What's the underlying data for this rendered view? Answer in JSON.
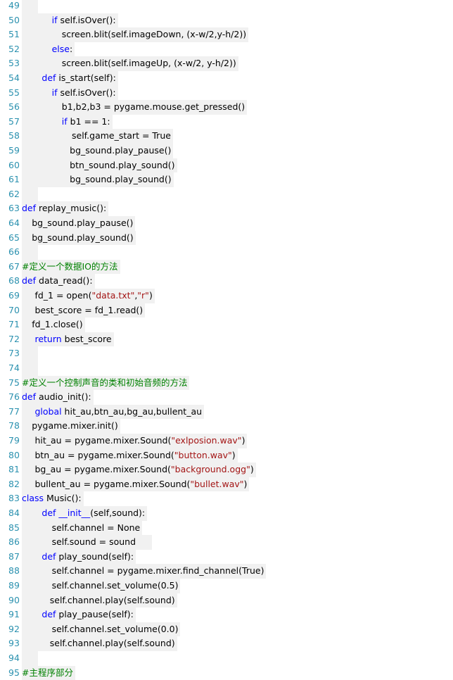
{
  "lines": [
    {
      "n": "49",
      "indent": 0,
      "t": []
    },
    {
      "n": "50",
      "indent": 3,
      "t": [
        [
          "kw",
          "if"
        ],
        [
          "n",
          " self.isOver():"
        ]
      ]
    },
    {
      "n": "51",
      "indent": 4,
      "t": [
        [
          "n",
          "screen.blit(self.imageDown, (x-w/2,y-h/2))"
        ]
      ]
    },
    {
      "n": "52",
      "indent": 3,
      "t": [
        [
          "kw",
          "else"
        ],
        [
          "n",
          ":"
        ]
      ]
    },
    {
      "n": "53",
      "indent": 4,
      "t": [
        [
          "n",
          "screen.blit(self.imageUp, (x-w/2, y-h/2))"
        ]
      ]
    },
    {
      "n": "54",
      "indent": 2,
      "t": [
        [
          "kw",
          "def"
        ],
        [
          "n",
          " is_start(self):"
        ]
      ]
    },
    {
      "n": "55",
      "indent": 3,
      "t": [
        [
          "kw",
          "if"
        ],
        [
          "n",
          " self.isOver():"
        ]
      ]
    },
    {
      "n": "56",
      "indent": 4,
      "t": [
        [
          "n",
          "b1,b2,b3 = pygame.mouse.get_pressed()"
        ]
      ]
    },
    {
      "n": "57",
      "indent": 4,
      "t": [
        [
          "kw",
          "if"
        ],
        [
          "n",
          " b1 == 1:"
        ]
      ]
    },
    {
      "n": "58",
      "indent": 5,
      "t": [
        [
          "n",
          "self.game_start = True"
        ]
      ]
    },
    {
      "n": "59",
      "indent": 4.8,
      "t": [
        [
          "n",
          "bg_sound.play_pause()"
        ]
      ]
    },
    {
      "n": "60",
      "indent": 4.8,
      "t": [
        [
          "n",
          "btn_sound.play_sound()"
        ]
      ]
    },
    {
      "n": "61",
      "indent": 4.8,
      "t": [
        [
          "n",
          "bg_sound.play_sound()"
        ]
      ]
    },
    {
      "n": "62",
      "indent": 0,
      "t": []
    },
    {
      "n": "63",
      "indent": 0,
      "t": [
        [
          "kw",
          "def"
        ],
        [
          "n",
          " replay_music():"
        ]
      ]
    },
    {
      "n": "64",
      "indent": 1,
      "t": [
        [
          "n",
          "bg_sound.play_pause()"
        ]
      ]
    },
    {
      "n": "65",
      "indent": 1,
      "t": [
        [
          "n",
          "bg_sound.play_sound()"
        ]
      ]
    },
    {
      "n": "66",
      "indent": 0,
      "t": []
    },
    {
      "n": "67",
      "indent": 0,
      "t": [
        [
          "cmt",
          "#定义一个数据IO的方法"
        ]
      ]
    },
    {
      "n": "68",
      "indent": 0,
      "t": [
        [
          "kw",
          "def"
        ],
        [
          "n",
          " data_read():"
        ]
      ]
    },
    {
      "n": "69",
      "indent": 1.3,
      "t": [
        [
          "n",
          "fd_1 = open("
        ],
        [
          "str",
          "\"data.txt\""
        ],
        [
          "n",
          ","
        ],
        [
          "str",
          "\"r\""
        ],
        [
          "n",
          ")"
        ]
      ]
    },
    {
      "n": "70",
      "indent": 1.3,
      "t": [
        [
          "n",
          "best_score = fd_1.read()"
        ]
      ]
    },
    {
      "n": "71",
      "indent": 1,
      "t": [
        [
          "n",
          "fd_1.close()"
        ]
      ]
    },
    {
      "n": "72",
      "indent": 1.3,
      "t": [
        [
          "kw",
          "return"
        ],
        [
          "n",
          " best_score"
        ]
      ]
    },
    {
      "n": "73",
      "indent": 0,
      "t": []
    },
    {
      "n": "74",
      "indent": 0,
      "t": []
    },
    {
      "n": "75",
      "indent": 0,
      "t": [
        [
          "cmt",
          "#定义一个控制声音的类和初始音频的方法"
        ]
      ]
    },
    {
      "n": "76",
      "indent": 0,
      "t": [
        [
          "kw",
          "def"
        ],
        [
          "n",
          " audio_init():"
        ]
      ]
    },
    {
      "n": "77",
      "indent": 1.3,
      "t": [
        [
          "kw",
          "global"
        ],
        [
          "n",
          " hit_au,btn_au,bg_au,bullent_au"
        ]
      ]
    },
    {
      "n": "78",
      "indent": 1,
      "t": [
        [
          "n",
          "pygame.mixer.init()"
        ]
      ]
    },
    {
      "n": "79",
      "indent": 1.3,
      "t": [
        [
          "n",
          "hit_au = pygame.mixer.Sound("
        ],
        [
          "str",
          "\"exlposion.wav\""
        ],
        [
          "n",
          ")"
        ]
      ]
    },
    {
      "n": "80",
      "indent": 1.3,
      "t": [
        [
          "n",
          "btn_au = pygame.mixer.Sound("
        ],
        [
          "str",
          "\"button.wav\""
        ],
        [
          "n",
          ")"
        ]
      ]
    },
    {
      "n": "81",
      "indent": 1.3,
      "t": [
        [
          "n",
          "bg_au = pygame.mixer.Sound("
        ],
        [
          "str",
          "\"background.ogg\""
        ],
        [
          "n",
          ")"
        ]
      ]
    },
    {
      "n": "82",
      "indent": 1.3,
      "t": [
        [
          "n",
          "bullent_au = pygame.mixer.Sound("
        ],
        [
          "str",
          "\"bullet.wav\""
        ],
        [
          "n",
          ")"
        ]
      ]
    },
    {
      "n": "83",
      "indent": 0,
      "t": [
        [
          "kw",
          "class"
        ],
        [
          "n",
          " Music():"
        ]
      ]
    },
    {
      "n": "84",
      "indent": 2,
      "t": [
        [
          "kw",
          "def"
        ],
        [
          "n",
          " "
        ],
        [
          "kw",
          "__init__"
        ],
        [
          "n",
          "(self,sound):"
        ]
      ]
    },
    {
      "n": "85",
      "indent": 3,
      "t": [
        [
          "n",
          "self.channel = None"
        ]
      ]
    },
    {
      "n": "86",
      "indent": 3,
      "t": [
        [
          "n",
          "self.sound = sound     "
        ]
      ]
    },
    {
      "n": "87",
      "indent": 2,
      "t": [
        [
          "kw",
          "def"
        ],
        [
          "n",
          " play_sound(self):"
        ]
      ]
    },
    {
      "n": "88",
      "indent": 3,
      "t": [
        [
          "n",
          "self.channel = pygame.mixer.find_channel(True)"
        ]
      ]
    },
    {
      "n": "89",
      "indent": 3,
      "t": [
        [
          "n",
          "self.channel.set_volume(0.5)"
        ]
      ]
    },
    {
      "n": "90",
      "indent": 2.8,
      "t": [
        [
          "n",
          "self.channel.play(self.sound)"
        ]
      ]
    },
    {
      "n": "91",
      "indent": 2,
      "t": [
        [
          "kw",
          "def"
        ],
        [
          "n",
          " play_pause(self):"
        ]
      ]
    },
    {
      "n": "92",
      "indent": 3,
      "t": [
        [
          "n",
          "self.channel.set_volume(0.0)"
        ]
      ]
    },
    {
      "n": "93",
      "indent": 2.8,
      "t": [
        [
          "n",
          "self.channel.play(self.sound)"
        ]
      ]
    },
    {
      "n": "94",
      "indent": 0,
      "t": []
    },
    {
      "n": "95",
      "indent": 0,
      "t": [
        [
          "cmt",
          "#主程序部分"
        ]
      ]
    }
  ],
  "colors": {
    "line_number": "#2b91af",
    "keyword": "#0000ff",
    "string": "#a31515",
    "comment": "#008000",
    "highlight": "#f1f1f1"
  }
}
